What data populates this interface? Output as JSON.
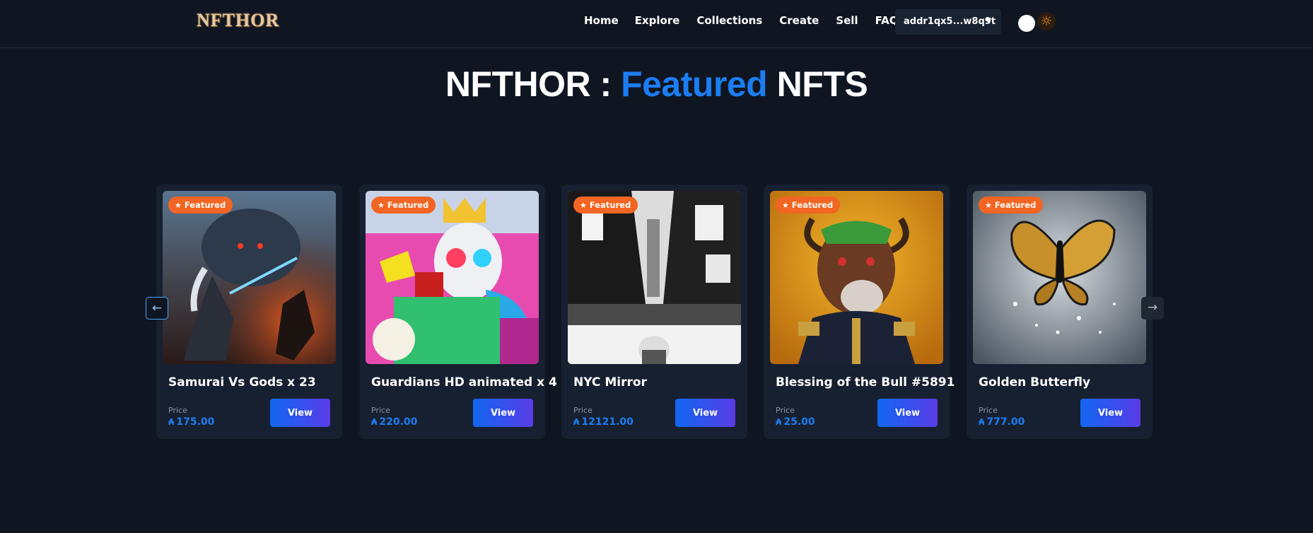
{
  "navbar": {
    "logo": "NFTHOR",
    "links": [
      "Home",
      "Explore",
      "Collections",
      "Create",
      "Sell",
      "FAQ"
    ],
    "wallet": "addr1qx5...w8q9t",
    "theme_icon": "sun-icon"
  },
  "heading": {
    "prefix": "NFTHOR : ",
    "accent": "Featured",
    "suffix": " NFTS"
  },
  "colors": {
    "accent": "#1c7df2",
    "badge": "#f26522",
    "background": "#0f1621",
    "card": "#172030"
  },
  "cards": [
    {
      "badge": "Featured",
      "title": "Samurai Vs Gods x 23",
      "price_label": "Price",
      "price": "175.00",
      "button": "View"
    },
    {
      "badge": "Featured",
      "title": "Guardians HD animated x 4",
      "price_label": "Price",
      "price": "220.00",
      "button": "View"
    },
    {
      "badge": "Featured",
      "title": "NYC Mirror",
      "price_label": "Price",
      "price": "12121.00",
      "button": "View"
    },
    {
      "badge": "Featured",
      "title": "Blessing of the Bull #5891",
      "price_label": "Price",
      "price": "25.00",
      "button": "View"
    },
    {
      "badge": "Featured",
      "title": "Golden Butterfly",
      "price_label": "Price",
      "price": "777.00",
      "button": "View"
    }
  ],
  "carousel": {
    "prev_icon": "arrow-left-icon",
    "next_icon": "arrow-right-icon",
    "prev_glyph": "←",
    "next_glyph": "→"
  }
}
